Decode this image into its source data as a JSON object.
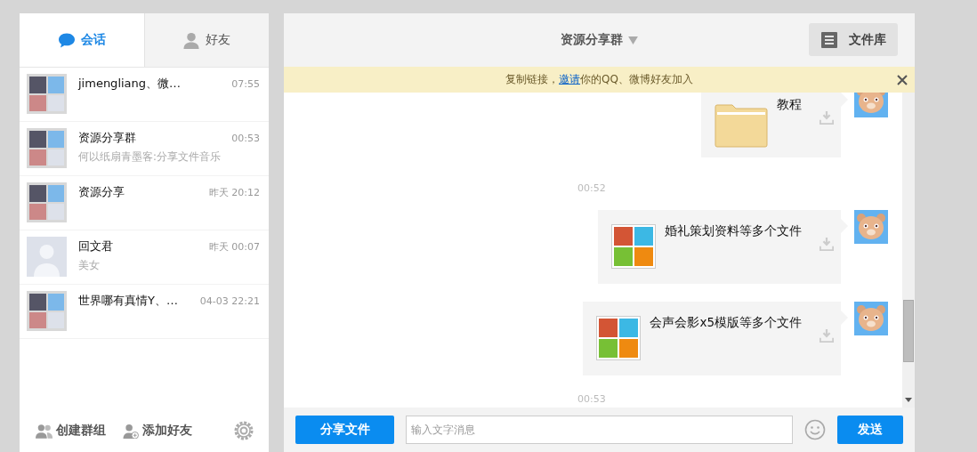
{
  "sidebar": {
    "tabs": [
      {
        "label": "会话",
        "kind": "chat",
        "selected": true
      },
      {
        "label": "好友",
        "kind": "friends",
        "selected": false
      }
    ],
    "conversations": [
      {
        "name": "jimengliang、微…",
        "time": "07:55",
        "kind": "group"
      },
      {
        "name": "资源分享群",
        "time": "00:53",
        "preview": "何以纸扇青墨客:分享文件音乐",
        "kind": "group"
      },
      {
        "name": "资源分享",
        "time": "昨天 20:12",
        "kind": "group"
      },
      {
        "name": "回文君",
        "time": "昨天 00:07",
        "preview": "美女",
        "kind": "person"
      },
      {
        "name": "世界哪有真情Y、…",
        "time": "04-03 22:21",
        "kind": "group"
      }
    ],
    "footer": {
      "create_group": "创建群组",
      "add_friend": "添加好友"
    }
  },
  "chat": {
    "title": "资源分享群",
    "file_library": "文件库",
    "notice": {
      "before": "复制链接，",
      "link": "邀请",
      "after": "你的QQ、微博好友加入"
    },
    "messages": [
      {
        "kind": "folder",
        "name": "教程"
      },
      {
        "kind": "time",
        "text": "00:52"
      },
      {
        "kind": "files",
        "name": "婚礼策划资料等多个文件"
      },
      {
        "kind": "files",
        "name": "会声会影x5模版等多个文件"
      },
      {
        "kind": "time",
        "text": "00:53"
      }
    ],
    "composer": {
      "share_button": "分享文件",
      "placeholder": "输入文字消息",
      "send_button": "发送"
    }
  }
}
